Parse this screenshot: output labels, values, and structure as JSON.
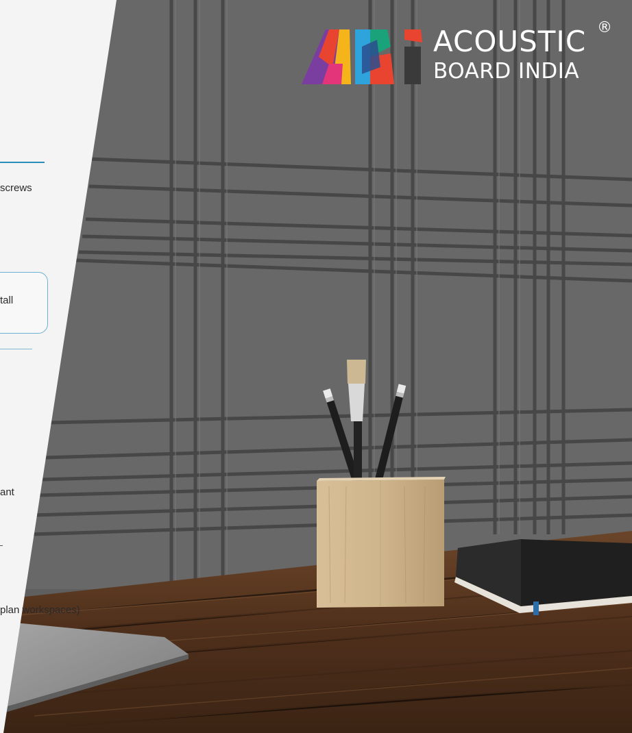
{
  "brand": {
    "line1": "ACOUSTIC",
    "line2": "BOARD INDIA",
    "registered": "®",
    "logo_letters": "ABi",
    "colors": [
      "#e9442f",
      "#7a3ea1",
      "#f4b41a",
      "#2ea3dc",
      "#1aa37a",
      "#e2357a",
      "#2b4f8f",
      "#3a3a3a"
    ]
  },
  "panel": {
    "line_screws": "screws",
    "line_install": "tall",
    "line_ant": "ant",
    "line_workspaces": "plan workspaces)"
  },
  "colors": {
    "wall": "#6a6a6a",
    "groove": "#4a4a4a",
    "desk": "#5a3a24",
    "panel": "#f4f4f4",
    "accent": "#2a8fb8"
  }
}
